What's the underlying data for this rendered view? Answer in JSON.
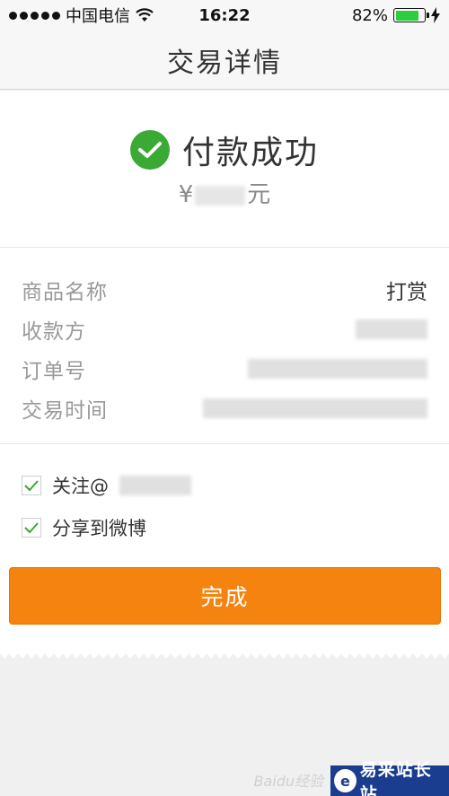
{
  "status_bar": {
    "carrier": "中国电信",
    "time": "16:22",
    "battery": "82%",
    "battery_level": 0.82,
    "battery_color": "#2ecc40"
  },
  "nav": {
    "title": "交易详情"
  },
  "payment": {
    "status": "付款成功",
    "currency_symbol": "¥",
    "amount_suffix": "元",
    "status_color": "#3aaa35"
  },
  "details": {
    "rows": [
      {
        "label": "商品名称",
        "value": "打赏"
      },
      {
        "label": "收款方",
        "value": ""
      },
      {
        "label": "订单号",
        "value": ""
      },
      {
        "label": "交易时间",
        "value": ""
      }
    ]
  },
  "options": [
    {
      "label": "关注@",
      "checked": true
    },
    {
      "label": "分享到微博",
      "checked": true
    }
  ],
  "done_button": {
    "label": "完成",
    "color": "#f5830f"
  },
  "footer": {
    "brand": "易采站长站",
    "watermark": "Baidu经验"
  },
  "icons": {
    "success": "check-circle-icon",
    "wifi": "wifi-icon",
    "battery": "battery-icon",
    "charging": "lightning-icon"
  }
}
